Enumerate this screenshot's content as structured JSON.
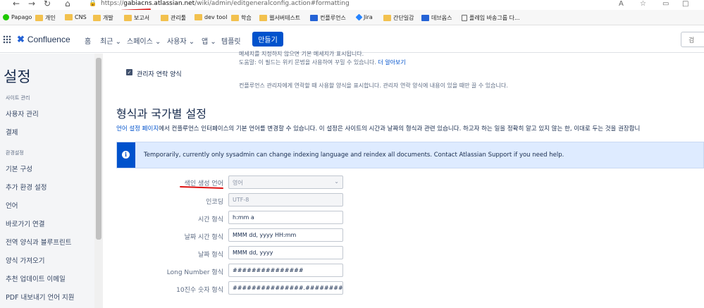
{
  "browser": {
    "url_prefix": "https://",
    "url_host": "gabiacns.atlassian.net",
    "url_path": "/wiki/admin/editgeneralconfig.action#formatting",
    "bookmarks": [
      {
        "label": "Papago",
        "icon": "papago-icon"
      },
      {
        "label": "개인",
        "icon": "folder-icon"
      },
      {
        "label": "CNS",
        "icon": "folder-icon"
      },
      {
        "label": "개발",
        "icon": "folder-icon"
      },
      {
        "label": "보고서",
        "icon": "folder-icon"
      },
      {
        "label": "관리툴",
        "icon": "folder-icon"
      },
      {
        "label": "dev tool",
        "icon": "folder-icon"
      },
      {
        "label": "학습",
        "icon": "folder-icon"
      },
      {
        "label": "웹서버테스트",
        "icon": "folder-icon"
      },
      {
        "label": "컨플루언스",
        "icon": "confluence-icon"
      },
      {
        "label": "Jira",
        "icon": "jira-icon"
      },
      {
        "label": "간단일감",
        "icon": "folder-icon"
      },
      {
        "label": "데브옵스",
        "icon": "confluence-icon"
      },
      {
        "label": "플레임 바송그룹 다...",
        "icon": "page-icon"
      }
    ]
  },
  "header": {
    "logo": "Confluence",
    "nav": [
      "홈",
      "최근",
      "스페이스",
      "사용자",
      "앱",
      "템플릿"
    ],
    "create_label": "만들기",
    "search_placeholder": "검"
  },
  "sidebar": {
    "title": "설정",
    "section1": "사이트 관리",
    "items1": [
      "사용자 관리",
      "결제"
    ],
    "section2": "환경설정",
    "items2": [
      "기본 구성",
      "추가 환경 설정",
      "언어",
      "바로가기 연결",
      "전역 양식과 블루프린트",
      "양식 가져오기",
      "추천 업데이트 이메일",
      "PDF 내보내기 언어 지원"
    ]
  },
  "main": {
    "top_line1": "메세지를 지정하지 않으면 기본 메세지가 표시됩니다.",
    "top_line2": "도움말: 이 필드는 위키 문법을 사용하여 꾸밀 수 있습니다.",
    "learn_more": "더 알아보기",
    "admin_contact_label": "관리자 연락 양식",
    "admin_contact_desc": "컨플루언스 관리자에게 연락할 때 사용할 양식을 표시합니다. 관리자 연락 양식에 내용이 있을 때만 끌 수 있습니다.",
    "section_title": "형식과 국가별 설정",
    "desc_link": "언어 설정 페이지",
    "desc_text": "에서 컨플루언스 인터페이스의 기본 언어를 변경할 수 있습니다. 이 설정은 사이트의 시간과 날짜의 형식과 관련 있습니다. 하고자 하는 일을 정확히 알고 있지 않는 한, 이대로 두는 것을 권장합니",
    "info_message": "Temporarily, currently only sysadmin can change indexing language and reindex all documents. Contact Atlassian Support if you need help.",
    "fields": {
      "index_lang_label": "색인 생성 언어",
      "index_lang_value": "영어",
      "encoding_label": "인코딩",
      "encoding_value": "UTF-8",
      "time_label": "시간 형식",
      "time_value": "h:mm a",
      "datetime_label": "날짜 시간 형식",
      "datetime_value": "MMM dd, yyyy HH:mm",
      "date_label": "날짜 형식",
      "date_value": "MMM dd, yyyy",
      "long_label": "Long Number 형식",
      "long_value": "###############",
      "decimal_label": "10진수 숫자 형식",
      "decimal_value": "###############.##########"
    }
  }
}
